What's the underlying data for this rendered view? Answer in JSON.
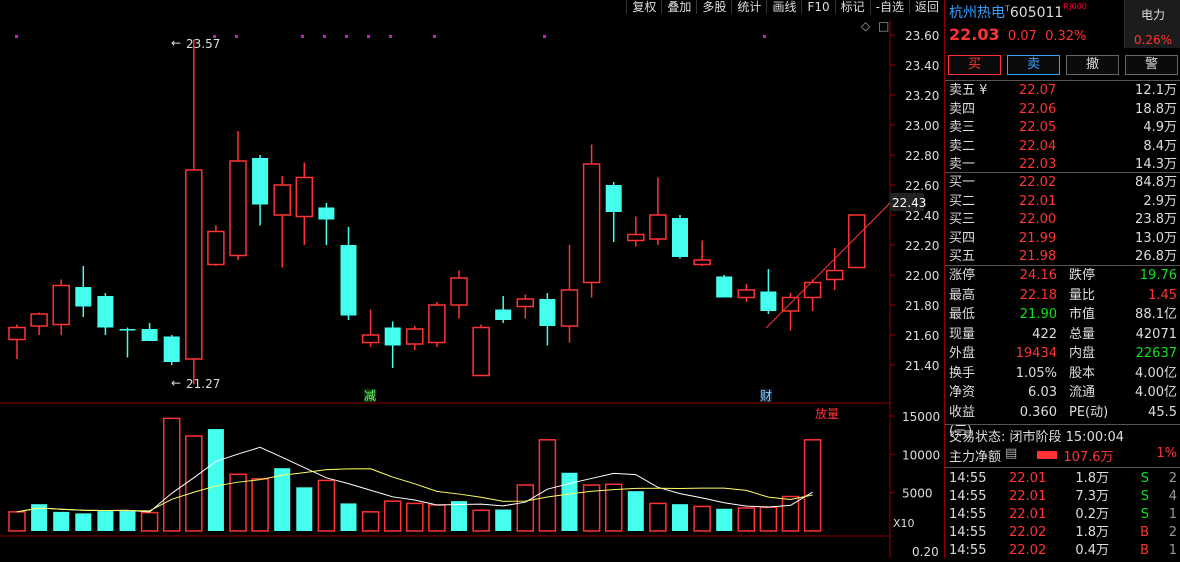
{
  "toolbar": [
    "复权",
    "叠加",
    "多股",
    "统计",
    "画线",
    "F10",
    "标记",
    "-自选",
    "返回"
  ],
  "header": {
    "name": "杭州热电",
    "t_mark": "T",
    "code": "605011",
    "rz_mark": "R|000",
    "price": "22.03",
    "change": "0.07",
    "change_pct": "0.32%"
  },
  "sector": {
    "name": "电力",
    "pct": "0.26%"
  },
  "actions": {
    "buy": "买",
    "sell": "卖",
    "cancel": "撤",
    "alert": "警"
  },
  "asks": [
    {
      "label": "卖五 ¥",
      "price": "22.07",
      "vol": "12.1万"
    },
    {
      "label": "卖四",
      "price": "22.06",
      "vol": "18.8万"
    },
    {
      "label": "卖三",
      "price": "22.05",
      "vol": "4.9万"
    },
    {
      "label": "卖二",
      "price": "22.04",
      "vol": "8.4万"
    },
    {
      "label": "卖一",
      "price": "22.03",
      "vol": "14.3万"
    }
  ],
  "bids": [
    {
      "label": "买一",
      "price": "22.02",
      "vol": "84.8万"
    },
    {
      "label": "买二",
      "price": "22.01",
      "vol": "2.9万"
    },
    {
      "label": "买三",
      "price": "22.00",
      "vol": "23.8万"
    },
    {
      "label": "买四",
      "price": "21.99",
      "vol": "13.0万"
    },
    {
      "label": "买五",
      "price": "21.98",
      "vol": "26.8万"
    }
  ],
  "stats": [
    {
      "k": "涨停",
      "v": "24.16",
      "vc": "red",
      "k2": "跌停",
      "v2": "19.76",
      "v2c": "grn"
    },
    {
      "k": "最高",
      "v": "22.18",
      "vc": "red",
      "k2": "量比",
      "v2": "1.45",
      "v2c": "red"
    },
    {
      "k": "最低",
      "v": "21.90",
      "vc": "grn",
      "k2": "市值",
      "v2": "88.1亿",
      "v2c": "wht"
    },
    {
      "k": "现量",
      "v": "422",
      "vc": "wht",
      "k2": "总量",
      "v2": "42071",
      "v2c": "wht"
    },
    {
      "k": "外盘",
      "v": "19434",
      "vc": "red",
      "k2": "内盘",
      "v2": "22637",
      "v2c": "grn"
    },
    {
      "k": "换手",
      "v": "1.05%",
      "vc": "wht",
      "k2": "股本",
      "v2": "4.00亿",
      "v2c": "wht"
    },
    {
      "k": "净资",
      "v": "6.03",
      "vc": "wht",
      "k2": "流通",
      "v2": "4.00亿",
      "v2c": "wht"
    },
    {
      "k": "收益(三)",
      "v": "0.360",
      "vc": "wht",
      "k2": "PE(动)",
      "v2": "45.5",
      "v2c": "wht"
    }
  ],
  "trade_state": "交易状态: 闭市阶段 15:00:04",
  "main_force": {
    "label": "主力净额",
    "value": "107.6万",
    "pct": "1%"
  },
  "ticks": [
    {
      "t": "14:55",
      "p": "22.01",
      "q": "1.8万",
      "s": "S",
      "n": "2"
    },
    {
      "t": "14:55",
      "p": "22.01",
      "q": "7.3万",
      "s": "S",
      "n": "4"
    },
    {
      "t": "14:55",
      "p": "22.01",
      "q": "0.2万",
      "s": "S",
      "n": "1"
    },
    {
      "t": "14:55",
      "p": "22.02",
      "q": "1.8万",
      "s": "B",
      "n": "2"
    },
    {
      "t": "14:55",
      "p": "22.02",
      "q": "0.4万",
      "s": "B",
      "n": "1"
    }
  ],
  "price_axis": [
    "23.60",
    "23.40",
    "23.20",
    "23.00",
    "22.80",
    "22.60",
    "22.40",
    "22.20",
    "22.00",
    "21.80",
    "21.60",
    "21.40"
  ],
  "last_price_tag": "22.43",
  "high_note": "23.57",
  "low_note": "21.27",
  "markers": {
    "jian": "减",
    "cai": "财",
    "fangliang": "放量"
  },
  "vol_axis": [
    "15000",
    "10000",
    "5000"
  ],
  "vol_unit": "X10",
  "bottom_tick": "0.20",
  "colors": {
    "up": "#ff3333",
    "down": "#44ffee",
    "ma1": "#ffffff",
    "ma2": "#ffff66"
  },
  "chart_data": {
    "type": "candlestick",
    "candles": [
      {
        "o": 21.57,
        "c": 21.65,
        "h": 21.67,
        "l": 21.44
      },
      {
        "o": 21.66,
        "c": 21.74,
        "h": 21.75,
        "l": 21.6
      },
      {
        "o": 21.67,
        "c": 21.93,
        "h": 21.97,
        "l": 21.6
      },
      {
        "o": 21.92,
        "c": 21.79,
        "h": 22.06,
        "l": 21.72
      },
      {
        "o": 21.86,
        "c": 21.65,
        "h": 21.88,
        "l": 21.6
      },
      {
        "o": 21.64,
        "c": 21.63,
        "h": 21.65,
        "l": 21.45
      },
      {
        "o": 21.64,
        "c": 21.56,
        "h": 21.68,
        "l": 21.56
      },
      {
        "o": 21.59,
        "c": 21.42,
        "h": 21.6,
        "l": 21.4
      },
      {
        "o": 21.44,
        "c": 22.7,
        "h": 23.57,
        "l": 21.27
      },
      {
        "o": 22.07,
        "c": 22.29,
        "h": 22.33,
        "l": 22.06
      },
      {
        "o": 22.13,
        "c": 22.76,
        "h": 22.96,
        "l": 22.1
      },
      {
        "o": 22.78,
        "c": 22.47,
        "h": 22.8,
        "l": 22.33
      },
      {
        "o": 22.4,
        "c": 22.6,
        "h": 22.66,
        "l": 22.05
      },
      {
        "o": 22.39,
        "c": 22.65,
        "h": 22.75,
        "l": 22.2
      },
      {
        "o": 22.45,
        "c": 22.37,
        "h": 22.48,
        "l": 22.2
      },
      {
        "o": 22.2,
        "c": 21.73,
        "h": 22.32,
        "l": 21.7
      },
      {
        "o": 21.55,
        "c": 21.6,
        "h": 21.77,
        "l": 21.52
      },
      {
        "o": 21.65,
        "c": 21.53,
        "h": 21.69,
        "l": 21.38
      },
      {
        "o": 21.54,
        "c": 21.64,
        "h": 21.66,
        "l": 21.5
      },
      {
        "o": 21.55,
        "c": 21.8,
        "h": 21.82,
        "l": 21.52
      },
      {
        "o": 21.8,
        "c": 21.98,
        "h": 22.03,
        "l": 21.71
      },
      {
        "o": 21.33,
        "c": 21.65,
        "h": 21.67,
        "l": 21.33
      },
      {
        "o": 21.77,
        "c": 21.7,
        "h": 21.86,
        "l": 21.68
      },
      {
        "o": 21.79,
        "c": 21.84,
        "h": 21.87,
        "l": 21.71
      },
      {
        "o": 21.84,
        "c": 21.66,
        "h": 21.88,
        "l": 21.53
      },
      {
        "o": 21.66,
        "c": 21.9,
        "h": 22.2,
        "l": 21.55
      },
      {
        "o": 21.95,
        "c": 22.74,
        "h": 22.87,
        "l": 21.85
      },
      {
        "o": 22.6,
        "c": 22.42,
        "h": 22.62,
        "l": 22.22
      },
      {
        "o": 22.23,
        "c": 22.27,
        "h": 22.39,
        "l": 22.19
      },
      {
        "o": 22.24,
        "c": 22.4,
        "h": 22.65,
        "l": 22.2
      },
      {
        "o": 22.38,
        "c": 22.12,
        "h": 22.4,
        "l": 22.11
      },
      {
        "o": 22.07,
        "c": 22.1,
        "h": 22.23,
        "l": 22.06
      },
      {
        "o": 21.99,
        "c": 21.85,
        "h": 22.0,
        "l": 21.85
      },
      {
        "o": 21.85,
        "c": 21.9,
        "h": 21.94,
        "l": 21.82
      },
      {
        "o": 21.89,
        "c": 21.76,
        "h": 22.04,
        "l": 21.74
      },
      {
        "o": 21.76,
        "c": 21.85,
        "h": 21.88,
        "l": 21.63
      },
      {
        "o": 21.85,
        "c": 21.95,
        "h": 21.97,
        "l": 21.76
      },
      {
        "o": 21.97,
        "c": 22.03,
        "h": 22.18,
        "l": 21.9
      },
      {
        "o": 22.05,
        "c": 22.4,
        "h": 22.4,
        "l": 22.05
      }
    ],
    "volumes": [
      2500,
      3500,
      2500,
      2300,
      2600,
      2600,
      2400,
      14700,
      12400,
      13300,
      7400,
      6800,
      8200,
      5700,
      6600,
      3600,
      2500,
      3900,
      3600,
      3400,
      3900,
      2700,
      2800,
      6000,
      11900,
      7600,
      6000,
      6100,
      5200,
      3600,
      3500,
      3200,
      2900,
      3000,
      3100,
      4500,
      11900
    ],
    "y_range": [
      21.27,
      23.6
    ],
    "vol_range": [
      0,
      15000
    ]
  }
}
